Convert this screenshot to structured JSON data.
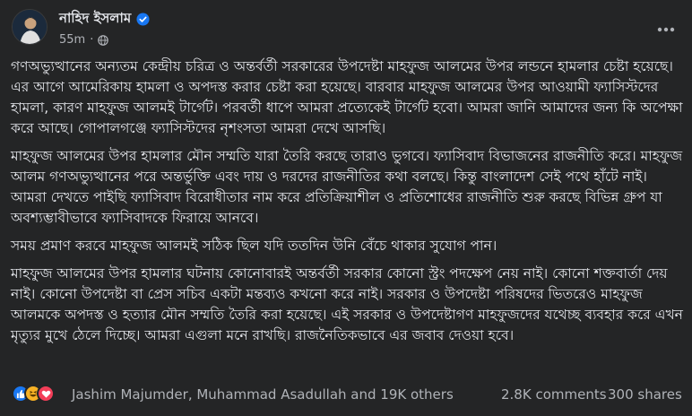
{
  "post": {
    "author": "নাহিদ ইসলাম",
    "time": "55m",
    "separator": "·",
    "paragraphs": [
      "গণঅভ্যুত্থানের অন্যতম কেন্দ্রীয় চরিত্র ও অন্তর্বর্তী সরকারের উপদেষ্টা মাহফুজ আলমের উপর লন্ডনে হামলার চেষ্টা হয়েছে। এর আগে আমেরিকায় হামলা ও অপদস্ত করার চেষ্টা করা হয়েছে। বারবার মাহফুজ আলমের উপর আওয়ামী ফ্যাসিস্টদের হামলা, কারণ মাহফুজ আলমই টার্গেট। পরবর্তী ধাপে আমরা প্রত্যেকেই টার্গেট হবো। আমরা জানি আমাদের জন্য কি অপেক্ষা করে আছে। গোপালগঞ্জে ফ্যাসিস্টদের নৃশংসতা আমরা দেখে আসছি।",
      "মাহফুজ আলমের উপর হামলার মৌন সম্মতি যারা তৈরি করছে তারাও ভুগবে। ফ্যাসিবাদ বিভাজনের রাজনীতি করে। মাহফুজ আলম গণঅভ্যুত্থানের পরে অন্তর্ভুক্তি এবং দায় ও দরদের রাজনীতির কথা বলছে। কিন্তু বাংলাদেশ সেই পথে হাঁটে নাই। আমরা দেখতে পাইছি ফ্যাসিবাদ বিরোধীতার নাম করে প্রতিক্রিয়াশীল ও প্রতিশোধের রাজনীতি শুরু করছে বিভিন্ন গ্রুপ যা অবশ্যম্ভাবীভাবে ফ্যাসিবাদকে ফিরায়ে আনবে।",
      "সময় প্রমাণ করবে মাহফুজ আলমই সঠিক ছিল যদি ততদিন উনি বেঁচে থাকার সুযোগ পান।",
      "মাহফুজ আলমের উপর হামলার ঘটনায় কোনোবারই অন্তর্বর্তী সরকার কোনো স্ট্রং পদক্ষেপ নেয় নাই। কোনো শক্তবার্তা দেয় নাই। কোনো উপদেষ্টা বা প্রেস সচিব একটা মন্তব্যও কখনো করে নাই। সরকার ও উপদেষ্টা পরিষদের ভিতরেও মাহফুজ আলমকে অপদস্ত ও হত্যার মৌন সম্মতি তৈরি করা হয়েছে। এই সরকার ও উপদেষ্টাগণ মাহফুজদের যথেচ্ছ ব্যবহার করে এখন মৃত্যুর মুখে ঠেলে দিচ্ছে। আমরা এগুলা মনে রাখছি। রাজনৈতিকভাবে এর জবাব দেওয়া হবে।"
    ]
  },
  "footer": {
    "reactions_text": "Jashim Majumder, Muhammad Asadullah and 19K others",
    "comments": "2.8K comments",
    "shares": "300 shares"
  },
  "colors": {
    "background": "#242526",
    "text": "#e4e6eb",
    "secondary": "#b0b3b8",
    "verified": "#1877f2"
  },
  "icons": [
    "avatar",
    "verified-badge-icon",
    "globe-icon",
    "more-options-icon",
    "like-reaction-icon",
    "haha-reaction-icon",
    "love-reaction-icon"
  ]
}
